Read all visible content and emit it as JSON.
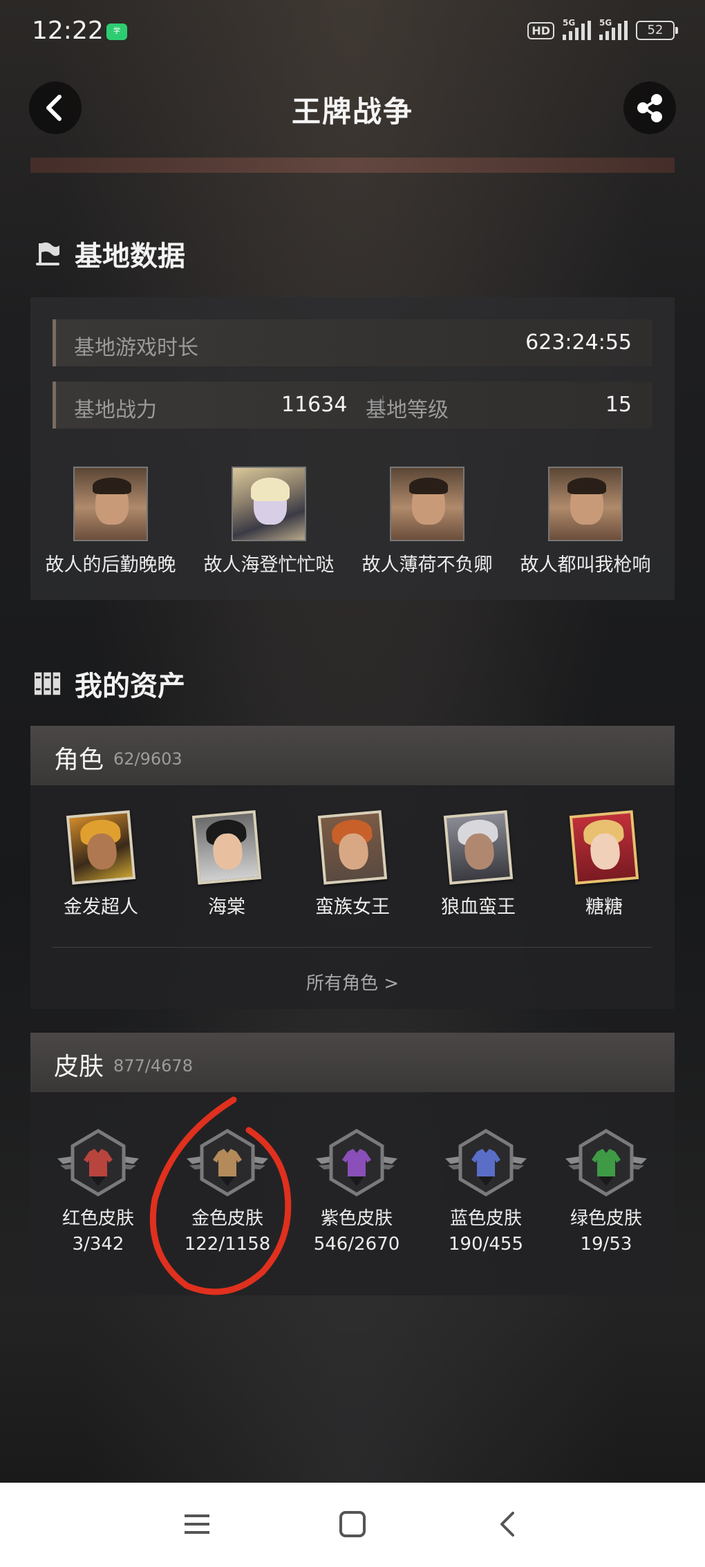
{
  "status_bar": {
    "time": "12:22",
    "app_badge": "学",
    "hd": "HD",
    "signal1": "5G",
    "signal2": "5G",
    "battery": "52"
  },
  "header": {
    "title": "王牌战争",
    "back_icon": "chevron-left-icon",
    "share_icon": "share-icon"
  },
  "base_section": {
    "title": "基地数据",
    "icon": "flag-icon",
    "play_time_label": "基地游戏时长",
    "play_time_value": "623:24:55",
    "power_label": "基地战力",
    "power_value": "11634",
    "level_label": "基地等级",
    "level_value": "15",
    "friends": [
      {
        "name": "故人的后勤晚晚"
      },
      {
        "name": "故人海登忙忙哒"
      },
      {
        "name": "故人薄荷不负卿"
      },
      {
        "name": "故人都叫我枪响"
      }
    ]
  },
  "assets_section": {
    "title": "我的资产",
    "icon": "books-icon",
    "roles": {
      "title": "角色",
      "count": "62/9603",
      "items": [
        {
          "name": "金发超人"
        },
        {
          "name": "海棠"
        },
        {
          "name": "蛮族女王"
        },
        {
          "name": "狼血蛮王"
        },
        {
          "name": "糖糖"
        }
      ],
      "all_link": "所有角色 >"
    },
    "skins": {
      "title": "皮肤",
      "count": "877/4678",
      "items": [
        {
          "name": "红色皮肤",
          "count": "3/342",
          "color": "#b8443e"
        },
        {
          "name": "金色皮肤",
          "count": "122/1158",
          "color": "#b48a5a"
        },
        {
          "name": "紫色皮肤",
          "count": "546/2670",
          "color": "#8a4fb8"
        },
        {
          "name": "蓝色皮肤",
          "count": "190/455",
          "color": "#5a6ec8"
        },
        {
          "name": "绿色皮肤",
          "count": "19/53",
          "color": "#3f9a46"
        }
      ]
    }
  },
  "annotation_color": "#e0301e",
  "nav_bar": {
    "menu_icon": "menu-icon",
    "home_icon": "square-icon",
    "back_icon": "triangle-back-icon"
  }
}
